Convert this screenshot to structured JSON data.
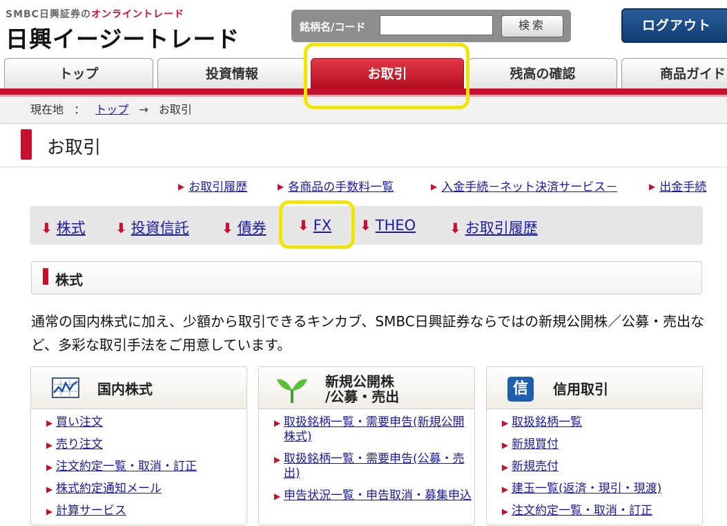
{
  "header": {
    "brand_small_prefix": "SMBC日興証券の",
    "brand_small_accent": "オンライントレード",
    "brand_big": "日興イージートレード",
    "search_label": "銘柄名/コード",
    "search_value": "",
    "search_button": "検索",
    "logout_button": "ログアウト"
  },
  "tabs": [
    {
      "label": "トップ"
    },
    {
      "label": "投資情報"
    },
    {
      "label": "お取引"
    },
    {
      "label": "残高の確認"
    },
    {
      "label": "商品ガイド"
    }
  ],
  "breadcrumb": {
    "current_label": "現在地",
    "sep": "：",
    "top_link": "トップ",
    "arrow": "→",
    "current": "お取引"
  },
  "page_title": "お取引",
  "top_links": [
    "お取引履歴",
    "各商品の手数料一覧",
    "入金手続－ネット決済サービス－",
    "出金手続"
  ],
  "anchor_nav": [
    "株式",
    "投資信託",
    "債券",
    "FX",
    "THEO",
    "お取引履歴"
  ],
  "section": {
    "title": "株式",
    "description": "通常の国内株式に加え、少額から取引できるキンカブ、SMBC日興証券ならではの新規公開株／公募・売出など、多彩な取引手法をご用意しています。"
  },
  "cards": [
    {
      "title": "国内株式",
      "links": [
        "買い注文",
        "売り注文",
        "注文約定一覧・取消・訂正",
        "株式約定通知メール",
        "計算サービス"
      ]
    },
    {
      "title_line1": "新規公開株",
      "title_line2": "/公募・売出",
      "links": [
        "取扱銘柄一覧・需要申告(新規公開株式)",
        "取扱銘柄一覧・需要申告(公募・売出)",
        "申告状況一覧・申告取消・募集申込"
      ]
    },
    {
      "title": "信用取引",
      "icon_text": "信",
      "links": [
        "取扱銘柄一覧",
        "新規買付",
        "新規売付",
        "建玉一覧(返済・現引・現渡)",
        "注文約定一覧・取消・訂正"
      ]
    }
  ],
  "colors": {
    "brand_red": "#c8102e",
    "logout_blue": "#1a4a85",
    "highlight_yellow": "#f2e600",
    "link_blue": "#1a1aa6"
  }
}
